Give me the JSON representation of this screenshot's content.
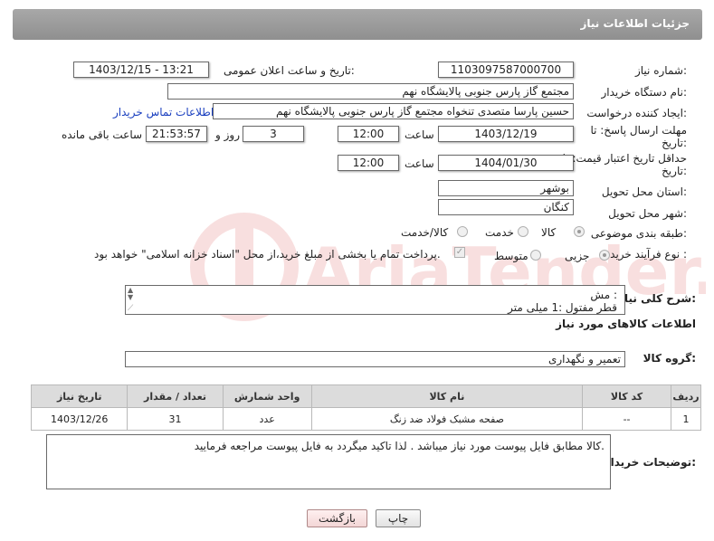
{
  "header": {
    "title": "جزئیات اطلاعات نیاز"
  },
  "fields": {
    "need_number": {
      "label": "شماره نیاز:",
      "value": "1103097587000700"
    },
    "announce_datetime": {
      "label": "تاریخ و ساعت اعلان عمومی:",
      "value": "1403/12/15 - 13:21"
    },
    "buyer_org": {
      "label": "نام دستگاه خریدار:",
      "value": "مجتمع گاز پارس جنوبی  پالایشگاه نهم"
    },
    "requester": {
      "label": "ایجاد کننده درخواست:",
      "value": "حسین پارسا متصدی تنخواه مجتمع گاز پارس جنوبی  پالایشگاه نهم",
      "contact_link": "اطلاعات تماس خریدار"
    },
    "reply_deadline": {
      "label_line1": "مهلت ارسال پاسخ: تا",
      "label_line2": "تاریخ:",
      "date": "1403/12/19",
      "time_label": "ساعت",
      "time": "12:00",
      "days": "3",
      "days_label": "روز و",
      "remaining": "21:53:57",
      "remaining_label": "ساعت باقی مانده"
    },
    "price_validity": {
      "label_line1": "حداقل تاریخ اعتبار قیمت: تا",
      "label_line2": "تاریخ:",
      "date": "1404/01/30",
      "time_label": "ساعت",
      "time": "12:00"
    },
    "province": {
      "label": "استان محل تحویل:",
      "value": "بوشهر"
    },
    "city": {
      "label": "شهر محل تحویل:",
      "value": "کنگان"
    },
    "category": {
      "label": "طبقه بندی موضوعی:",
      "options": [
        "کالا",
        "خدمت",
        "کالا/خدمت"
      ]
    },
    "purchase_type": {
      "label": "نوع فرآیند خرید :",
      "options": [
        "جزیی",
        "متوسط"
      ],
      "payment_note": "پرداخت تمام یا بخشی از مبلغ خرید،از محل \"اسناد خزانه اسلامی\" خواهد بود."
    }
  },
  "summary": {
    "label": "شرح کلی نیاز:",
    "line1": "مش :",
    "line2": "قطر مفتول :1 میلی متر"
  },
  "goods_section": {
    "title": "اطلاعات کالاهای مورد نیاز",
    "group_label": "گروه کالا:",
    "group_value": "تعمیر و نگهداری"
  },
  "table": {
    "headers": [
      "ردیف",
      "کد کالا",
      "نام کالا",
      "واحد شمارش",
      "تعداد / مقدار",
      "تاریخ نیاز"
    ],
    "rows": [
      [
        "1",
        "--",
        "صفحه مشبک فولاد ضد زنگ",
        "عدد",
        "31",
        "1403/12/26"
      ]
    ]
  },
  "buyer_notes": {
    "label": "توضیحات خریدار:",
    "text": "کالا مطابق فایل پیوست مورد نیاز میباشد . لذا تاکید میگردد به فایل پیوست مراجعه فرمایید."
  },
  "buttons": {
    "print": "چاپ",
    "back": "بازگشت"
  },
  "watermark": {
    "text": "AriaTender.neT"
  }
}
